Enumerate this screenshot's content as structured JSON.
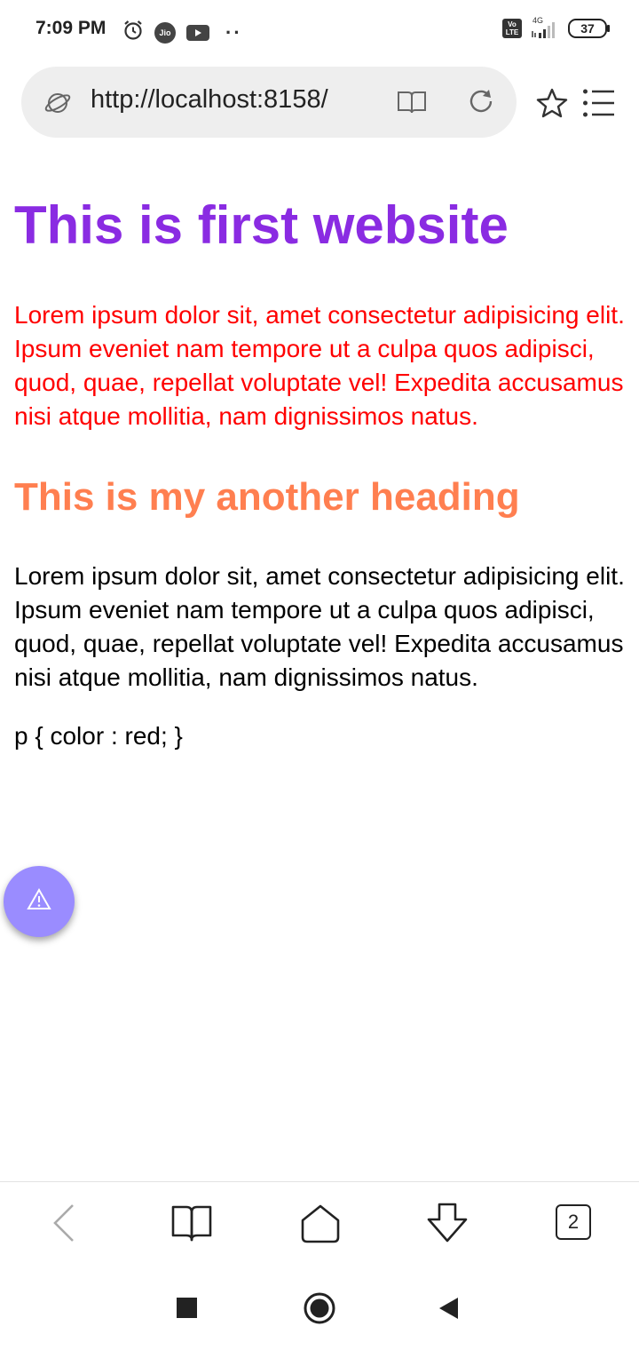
{
  "status_bar": {
    "time": "7:09 PM",
    "jio_label": "Jio",
    "volte_label_top": "Vo",
    "volte_label_bottom": "LTE",
    "network_type": "4G",
    "battery": "37",
    "icons": [
      "alarm-icon",
      "jio-icon",
      "youtube-icon",
      "more-dots-icon",
      "volte-icon",
      "signal-icon",
      "battery-icon"
    ]
  },
  "browser": {
    "url": "http://localhost:8158/",
    "icons": [
      "site-info-icon",
      "reader-mode-icon",
      "reload-icon",
      "bookmark-star-icon",
      "menu-icon"
    ]
  },
  "page": {
    "heading1": "This is first website",
    "paragraph1": "Lorem ipsum dolor sit, amet consectetur adipisicing elit. Ipsum eveniet nam tempore ut a culpa quos adipisci, quod, quae, repellat voluptate vel! Expedita accusamus nisi atque mollitia, nam dignissimos natus.",
    "heading2": "This is my another heading",
    "paragraph2": "Lorem ipsum dolor sit, amet consectetur adipisicing elit. Ipsum eveniet nam tempore ut a culpa quos adipisci, quod, quae, repellat voluptate vel! Expedita accusamus nisi atque mollitia, nam dignissimos natus.",
    "code_text": "p { color : red; }",
    "colors": {
      "heading1": "#8a2be2",
      "paragraph1": "#ff0000",
      "heading2": "#ff7f50",
      "fab": "#9a8cff"
    }
  },
  "fab": {
    "icon": "warning-icon"
  },
  "toolbar": {
    "tab_count": "2",
    "icons": [
      "back-icon",
      "bookmarks-icon",
      "home-icon",
      "download-icon",
      "tabs-icon"
    ]
  },
  "nav_bar": {
    "icons": [
      "recents-square-icon",
      "home-circle-icon",
      "back-triangle-icon"
    ]
  }
}
